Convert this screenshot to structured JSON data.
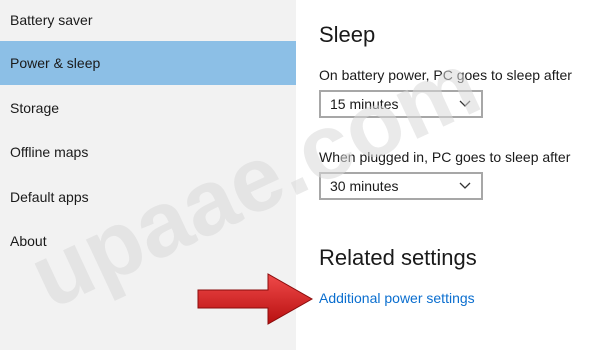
{
  "sidebar": {
    "items": [
      {
        "label": "Battery saver"
      },
      {
        "label": "Power & sleep"
      },
      {
        "label": "Storage"
      },
      {
        "label": "Offline maps"
      },
      {
        "label": "Default apps"
      },
      {
        "label": "About"
      }
    ],
    "selected_index": 1,
    "selected_color": "#8cbfe6"
  },
  "sleep": {
    "title": "Sleep",
    "battery_label": "On battery power, PC goes to sleep after",
    "battery_value": "15 minutes",
    "plugged_label": "When plugged in, PC goes to sleep after",
    "plugged_value": "30 minutes"
  },
  "related": {
    "title": "Related settings",
    "link_label": "Additional power settings",
    "link_color": "#0a6ecf"
  },
  "annotation": {
    "arrow_color": "#d81e1e",
    "icon": "right-arrow-icon"
  },
  "watermark": {
    "text": "upaae.com"
  }
}
